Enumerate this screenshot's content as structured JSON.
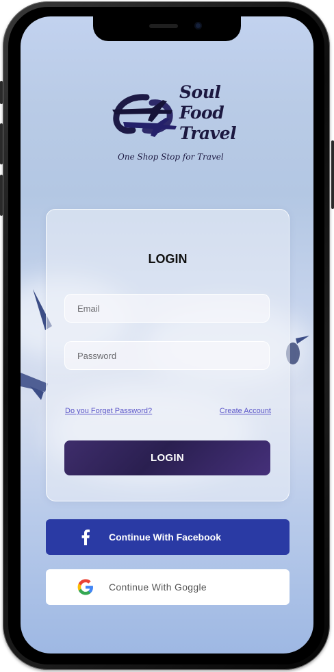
{
  "brand": {
    "line1": "Soul",
    "line2": "Food",
    "line3": "Travel",
    "tagline": "One Shop Stop for Travel",
    "logo_icon": "airplane-loop-icon"
  },
  "login_card": {
    "title": "LOGIN",
    "email_placeholder": "Email",
    "password_placeholder": "Password",
    "forgot_password_link": "Do you Forget Password?",
    "create_account_link": "Create Account",
    "login_button": "LOGIN"
  },
  "social": {
    "facebook_label": "Continue With Facebook",
    "facebook_icon": "facebook-icon",
    "google_label": "Continue With Goggle",
    "google_icon": "google-icon"
  },
  "colors": {
    "facebook": "#2a3aa4",
    "login_button": "#2e2358",
    "link": "#5a54c8",
    "brand": "#1c1840"
  }
}
